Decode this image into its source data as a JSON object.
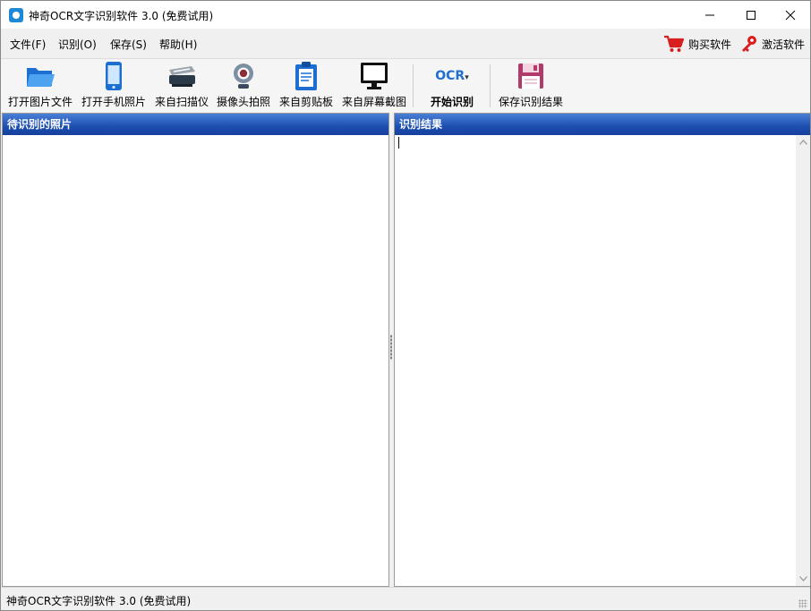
{
  "window": {
    "title": "神奇OCR文字识别软件 3.0 (免费试用)"
  },
  "menu": {
    "items": [
      {
        "label": "文件(F)"
      },
      {
        "label": "识别(O)"
      },
      {
        "label": "保存(S)"
      },
      {
        "label": "帮助(H)"
      }
    ],
    "buy_label": "购买软件",
    "activate_label": "激活软件"
  },
  "toolbar": {
    "open_image": "打开图片文件",
    "open_phone": "打开手机照片",
    "from_scanner": "来自扫描仪",
    "camera": "摄像头拍照",
    "from_clipboard": "来自剪贴板",
    "screenshot": "来自屏幕截图",
    "ocr_badge": "OCR",
    "start_ocr": "开始识别",
    "save_result": "保存识别结果"
  },
  "panes": {
    "left_title": "待识别的照片",
    "right_title": "识别结果"
  },
  "status": {
    "text": "神奇OCR文字识别软件 3.0 (免费试用)"
  },
  "colors": {
    "header_blue": "#1d4fb0",
    "ocr_blue": "#1e6fd0",
    "cart_red": "#d81e1e"
  }
}
